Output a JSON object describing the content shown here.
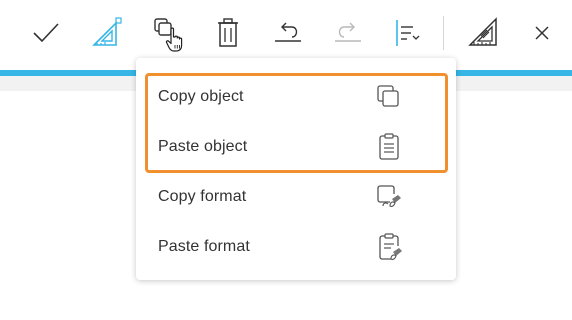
{
  "toolbar": {
    "buttons": [
      {
        "name": "confirm",
        "icon": "checkmark-icon"
      },
      {
        "name": "select-shape",
        "icon": "triangle-ruler-select-icon",
        "active_color": "#35b6e6"
      },
      {
        "name": "copy",
        "icon": "copy-icon"
      },
      {
        "name": "delete",
        "icon": "trash-icon"
      },
      {
        "name": "undo",
        "icon": "undo-icon"
      },
      {
        "name": "redo",
        "icon": "redo-icon",
        "disabled": true
      },
      {
        "name": "align",
        "icon": "align-left-dropdown-icon",
        "active_color": "#35b6e6"
      },
      {
        "name": "ruler",
        "icon": "ruler-icon"
      },
      {
        "name": "close",
        "icon": "close-icon"
      }
    ],
    "accent_color": "#35b6e6"
  },
  "menu": {
    "items": [
      {
        "label": "Copy object",
        "icon": "copy-icon"
      },
      {
        "label": "Paste object",
        "icon": "clipboard-icon"
      },
      {
        "label": "Copy format",
        "icon": "copy-format-icon"
      },
      {
        "label": "Paste format",
        "icon": "paste-format-icon"
      }
    ],
    "highlight_color": "#f0902f"
  }
}
